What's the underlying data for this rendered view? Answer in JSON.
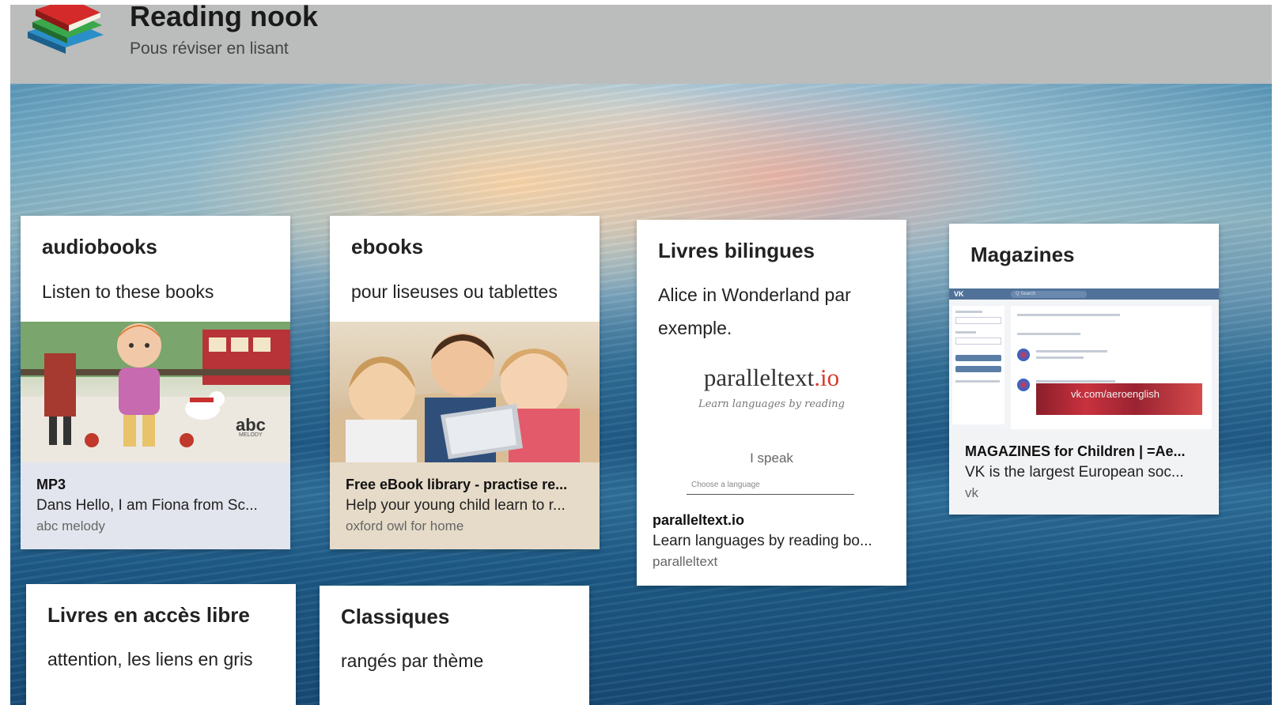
{
  "header": {
    "title": "Reading nook",
    "subtitle": "Pous réviser en lisant"
  },
  "colors": {
    "header_bg": "#bbbcbc",
    "card_bg": "#ffffff",
    "audio_meta_bg": "#e3e5ee",
    "ebook_meta_bg": "#e6dbc8",
    "mag_meta_bg": "#f2f3f5",
    "parallel_io_red": "#d83a2c"
  },
  "cards": [
    {
      "title": "audiobooks",
      "description": "Listen to these books",
      "link": {
        "title": "MP3",
        "description": "Dans Hello, I am Fiona from Sc...",
        "source": "abc melody",
        "preview_text": "abc",
        "preview_subtext": "MELODY"
      }
    },
    {
      "title": "ebooks",
      "description": "pour liseuses ou tablettes",
      "link": {
        "title": "Free eBook library - practise re...",
        "description": "Help your young child learn to r...",
        "source": "oxford owl for home"
      }
    },
    {
      "title": "Livres bilingues",
      "description": "Alice in Wonderland par exemple.",
      "preview": {
        "logo_main": "paralleltext",
        "logo_suffix": ".io",
        "tagline": "Learn languages by reading",
        "speak_label": "I speak",
        "select_placeholder": "Choose a language"
      },
      "link": {
        "title": "paralleltext.io",
        "description": "Learn languages by reading bo...",
        "source": "paralleltext"
      }
    },
    {
      "title": "Magazines",
      "preview": {
        "vk_logo": "VK",
        "vk_search": "Q Search",
        "watermark": "vk.com/aeroenglish"
      },
      "link": {
        "title": "MAGAZINES for Children | =Ae...",
        "description": "VK is the largest European soc...",
        "source": "vk"
      }
    },
    {
      "title": "Livres en accès libre",
      "description": "attention, les liens en gris"
    },
    {
      "title": "Classiques",
      "description": "rangés par thème"
    }
  ]
}
